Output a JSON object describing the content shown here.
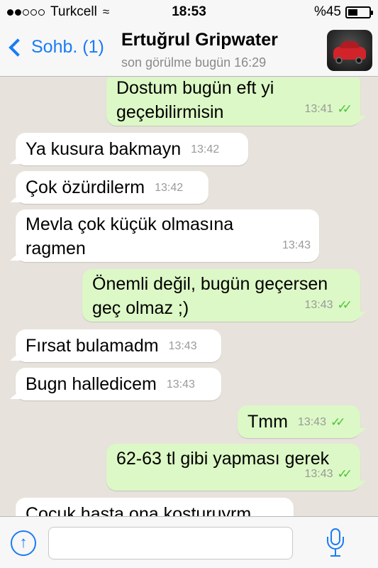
{
  "status_bar": {
    "carrier": "Turkcell",
    "time": "18:53",
    "battery_text": "%45",
    "battery_level": 0.45,
    "signal_dots_filled": 2,
    "signal_dots_total": 5,
    "wifi_icon": "wifi-icon"
  },
  "nav": {
    "back_label": "Sohb. (1)",
    "contact_name": "Ertuğrul Gripwater",
    "last_seen": "son görülme bugün 16:29",
    "accent": "#1a7cf5"
  },
  "messages": [
    {
      "dir": "out",
      "text": "Dostum bugün eft yi\ngeçebilirmisin",
      "time": "13:41",
      "read": true
    },
    {
      "dir": "in",
      "text": "Ya kusura bakmayn",
      "time": "13:42"
    },
    {
      "dir": "in",
      "text": "Çok özürdilerm",
      "time": "13:42"
    },
    {
      "dir": "in",
      "text": "Mevla çok küçük olmasına\nragmen",
      "time": "13:43"
    },
    {
      "dir": "out",
      "text": "Önemli değil, bugün geçersen\ngeç olmaz ;)",
      "time": "13:43",
      "read": true
    },
    {
      "dir": "in",
      "text": "Fırsat bulamadm",
      "time": "13:43"
    },
    {
      "dir": "in",
      "text": "Bugn halledicem",
      "time": "13:43"
    },
    {
      "dir": "out",
      "text": "Tmm",
      "time": "13:43",
      "read": true
    },
    {
      "dir": "out",
      "text": "62-63 tl gibi yapması gerek",
      "time": "13:43",
      "read": true
    },
    {
      "dir": "in",
      "text": "Çocuk hasta ona koşturuyrm",
      "time": ""
    }
  ],
  "input": {
    "value": "",
    "placeholder": ""
  },
  "colors": {
    "incoming_bubble": "#ffffff",
    "outgoing_bubble": "#dcf8c6",
    "read_ticks": "#4cc33a",
    "background": "#e7e3dc"
  }
}
